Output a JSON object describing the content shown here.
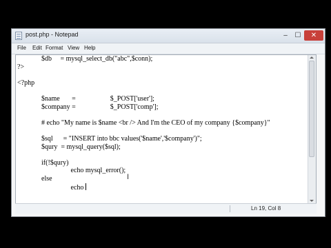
{
  "window": {
    "title": "post.php - Notepad",
    "controls": {
      "minimize": "–",
      "maximize": "☐",
      "close": "✕"
    }
  },
  "menubar": {
    "items": [
      "File",
      "Edit",
      "Format",
      "View",
      "Help"
    ]
  },
  "editor": {
    "lines_before_caret": [
      "              $db     = mysql_select_db(\"abc\",$conn);",
      "?>",
      "",
      "<?php",
      "",
      "              $name       =                    $_POST['user'];",
      "              $company =                    $_POST['comp'];",
      "",
      "              # echo \"My name is $name <br /> And I'm the CEO of my company {$company}\"",
      "",
      "              $sql      = \"INSERT into bbc values('$name','$company')\";",
      "              $qury  = mysql_query($sql);",
      "",
      "              if(!$qury)",
      "                               echo mysql_error();",
      "              else"
    ],
    "caret_line": "                               echo "
  },
  "statusbar": {
    "position": "Ln 19, Col 8"
  }
}
